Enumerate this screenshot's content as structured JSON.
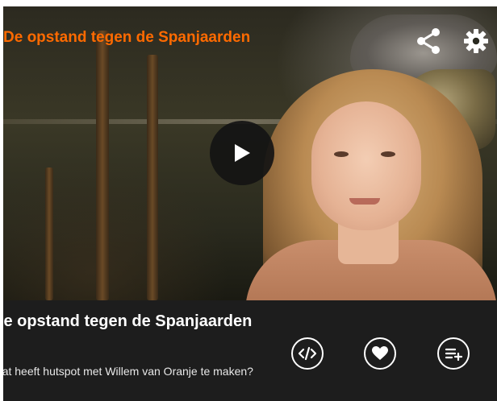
{
  "player": {
    "video_title": "De opstand tegen de Spanjaarden",
    "share_icon": "share-icon",
    "settings_icon": "gear-icon",
    "play_icon": "play-icon"
  },
  "info": {
    "title": "De opstand tegen de Spanjaarden",
    "description": "Wat heeft hutspot met Willem van Oranje te maken?",
    "actions": [
      {
        "icon": "embed-code-icon"
      },
      {
        "icon": "heart-icon"
      },
      {
        "icon": "add-to-playlist-icon"
      }
    ]
  },
  "colors": {
    "accent": "#ff6a00",
    "info_bg": "#1d1d1d",
    "icon": "#ffffff"
  }
}
